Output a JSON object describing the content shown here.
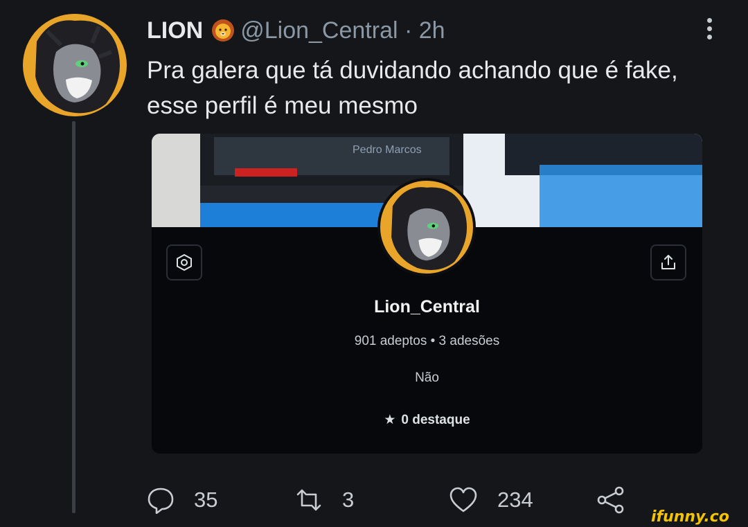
{
  "tweet": {
    "author_name": "LION",
    "author_handle": "@Lion_Central · 2h",
    "author_emoji": "lion-face-icon",
    "text": "Pra galera que tá duvidando achando que é fake, esse perfil é meu mesmo"
  },
  "embedded_profile": {
    "banner_overlay_text": "Pedro Marcos",
    "username": "Lion_Central",
    "stats": "901 adeptos • 3 adesões",
    "bio": "Não",
    "highlight_label": "0 destaque",
    "highlight_icon": "star-icon",
    "left_button_icon": "settings-icon",
    "right_button_icon": "share-upload-icon"
  },
  "actions": {
    "replies": "35",
    "retweets": "3",
    "likes": "234"
  },
  "watermark": "ifunny.co",
  "colors": {
    "background": "#15161a",
    "avatar_ring": "#e9a52a",
    "secondary_text": "#8b98a5",
    "watermark": "#f4c400"
  }
}
